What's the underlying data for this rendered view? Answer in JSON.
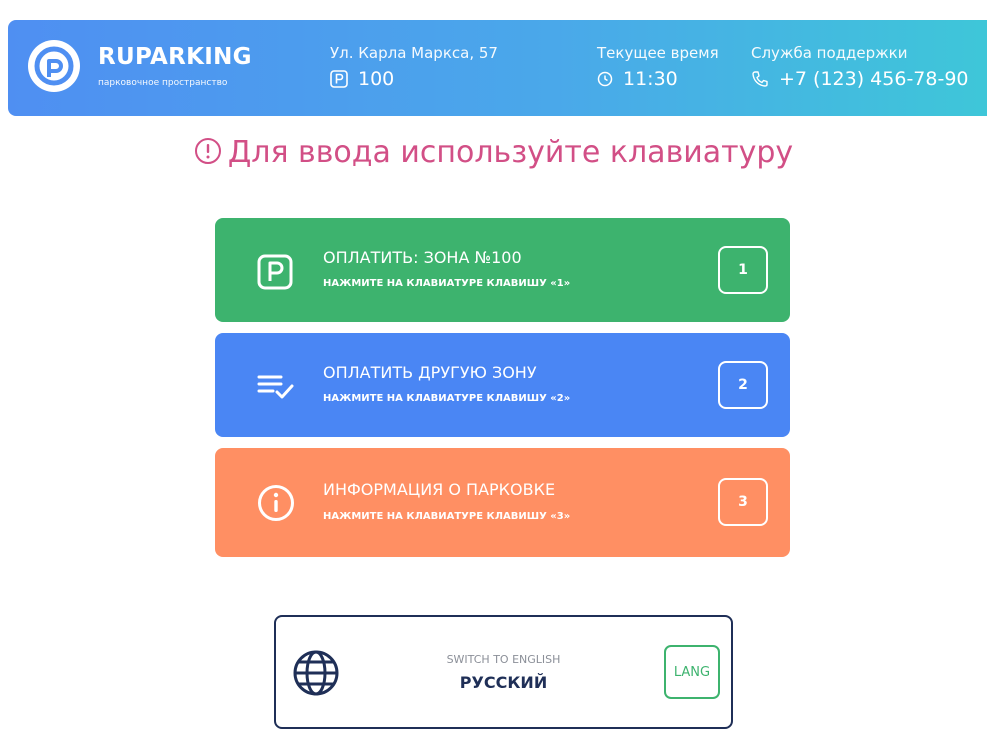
{
  "header": {
    "brand": {
      "name": "RUPARKING",
      "subtitle": "парковочное пространство"
    },
    "address": {
      "label": "Ул. Карла Маркса, 57",
      "zone": "100",
      "zone_icon": "parking-icon"
    },
    "time": {
      "label": "Текущее время",
      "value": "11:30",
      "icon": "clock-icon"
    },
    "support": {
      "label": "Служба поддержки",
      "phone": "+7 (123) 456-78-90",
      "icon": "phone-icon"
    }
  },
  "notice": {
    "text": "Для ввода используйте клавиатуру",
    "icon": "alert-circle-icon"
  },
  "options": [
    {
      "title": "ОПЛАТИТЬ: ЗОНА №100",
      "hint": "НАЖМИТЕ НА КЛАВИАТУРЕ КЛАВИШУ «1»",
      "key": "1",
      "icon": "parking-icon",
      "color": "#3db36e"
    },
    {
      "title": "ОПЛАТИТЬ ДРУГУЮ ЗОНУ",
      "hint": "НАЖМИТЕ НА КЛАВИАТУРЕ КЛАВИШУ «2»",
      "key": "2",
      "icon": "list-check-icon",
      "color": "#4a86f4"
    },
    {
      "title": "ИНФОРМАЦИЯ О ПАРКОВКЕ",
      "hint": "НАЖМИТЕ НА КЛАВИАТУРЕ КЛАВИШУ «3»",
      "key": "3",
      "icon": "info-icon",
      "color": "#ff8f63"
    }
  ],
  "language": {
    "switch_label": "SWITCH TO ENGLISH",
    "current": "РУССКИЙ",
    "key": "LANG",
    "icon": "globe-icon"
  },
  "colors": {
    "header_gradient_start": "#4f8ff2",
    "header_gradient_end": "#3ec7d8",
    "notice": "#d24f86",
    "lang_border": "#1f2f57",
    "lang_key": "#3db36e"
  }
}
